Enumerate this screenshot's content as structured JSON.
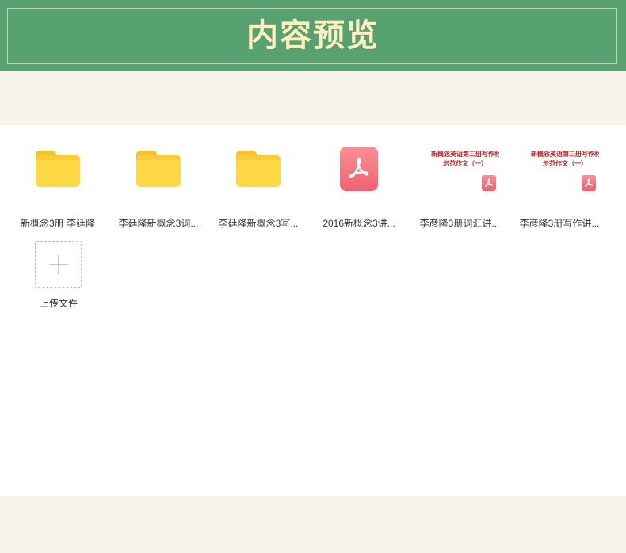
{
  "banner": {
    "title": "内容预览"
  },
  "files": [
    {
      "type": "folder",
      "name": "新概念3册 李廷隆"
    },
    {
      "type": "folder",
      "name": "李廷隆新概念3词..."
    },
    {
      "type": "folder",
      "name": "李廷隆新概念3写..."
    },
    {
      "type": "pdf",
      "name": "2016新概念3讲..."
    },
    {
      "type": "pdf-preview",
      "name": "李彦隆3册词汇讲...",
      "preview_line1": "新概念英语第三册写作材",
      "preview_line2": "示范作文（一）"
    },
    {
      "type": "pdf-preview",
      "name": "李彦隆3册写作讲...",
      "preview_line1": "新概念英语第三册写作材",
      "preview_line2": "示范作文（一）"
    }
  ],
  "upload": {
    "label": "上传文件",
    "icon": "plus-icon"
  },
  "colors": {
    "banner_bg": "#57a270",
    "banner_text": "#fbf0c2",
    "folder": "#fed845",
    "pdf": "#f0626f",
    "page_bg": "#f6f2ea"
  }
}
